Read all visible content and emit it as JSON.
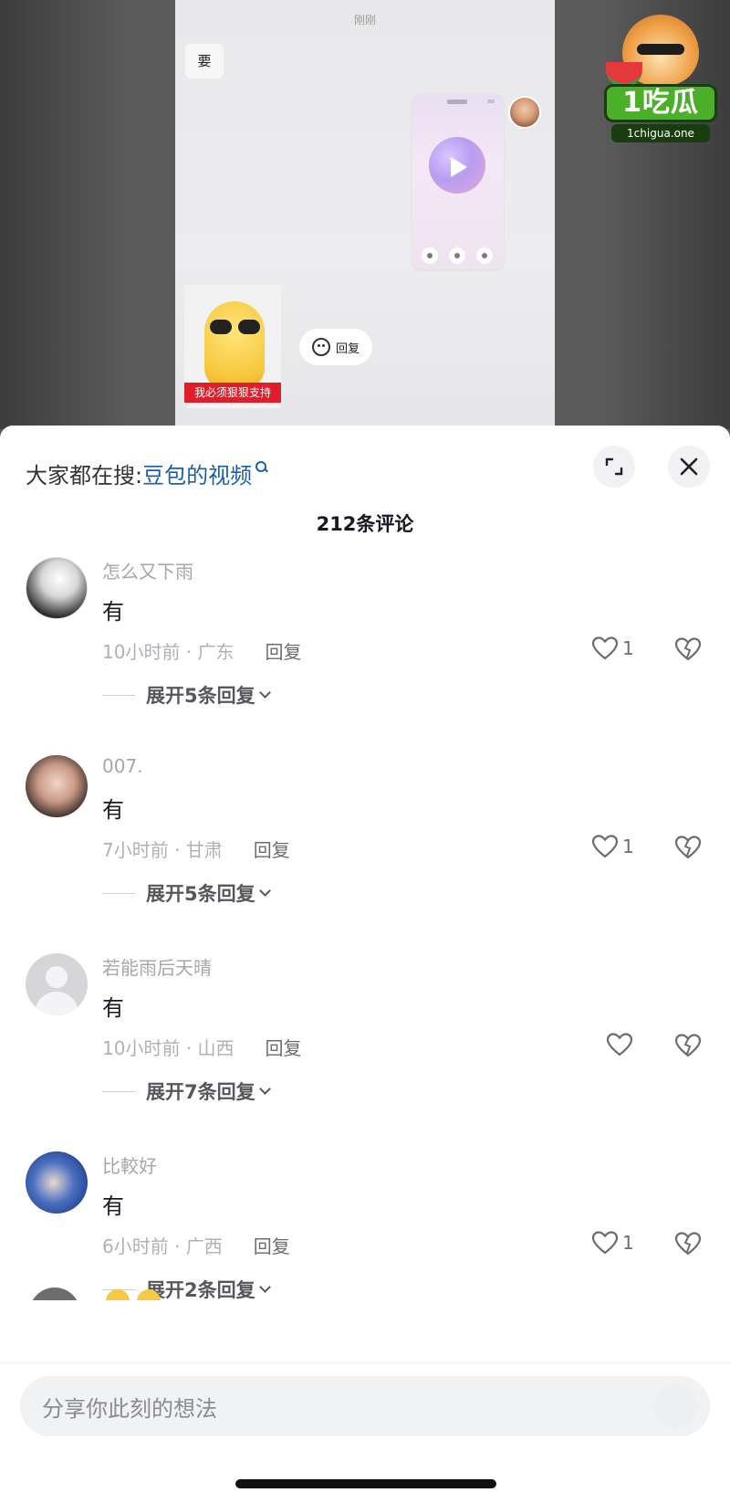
{
  "video": {
    "chat_time": "刚刚",
    "bubble_text": "要",
    "sticker_caption": "我必须狠狠支持",
    "reply_pill": "回复"
  },
  "watermark": {
    "logo_text": "1吃瓜",
    "domain": "1chigua.one"
  },
  "sheet": {
    "search_prefix": "大家都在搜:",
    "search_term": "豆包的视频",
    "comments_count": "212条评论"
  },
  "comments": [
    {
      "user": "怎么又下雨",
      "text": "有",
      "time_location": "10小时前 · 广东",
      "reply_label": "回复",
      "likes": "1",
      "expand_label": "展开5条回复"
    },
    {
      "user": "007.",
      "text": "有",
      "time_location": "7小时前 · 甘肃",
      "reply_label": "回复",
      "likes": "1",
      "expand_label": "展开5条回复"
    },
    {
      "user": "若能雨后天晴",
      "text": "有",
      "time_location": "10小时前 · 山西",
      "reply_label": "回复",
      "likes": "",
      "expand_label": "展开7条回复"
    },
    {
      "user": "比較好",
      "text": "有",
      "time_location": "6小时前 · 广西",
      "reply_label": "回复",
      "likes": "1",
      "expand_label": "展开2条回复"
    }
  ],
  "input": {
    "placeholder": "分享你此刻的想法"
  },
  "icons": {
    "expand": "expand-icon",
    "close": "close-icon",
    "like": "heart-icon",
    "dislike": "broken-heart-icon",
    "search": "search-icon"
  },
  "colors": {
    "link_blue": "#1b5fa8",
    "sticker_red": "#e01d2a",
    "logo_green": "#4caf2a"
  }
}
